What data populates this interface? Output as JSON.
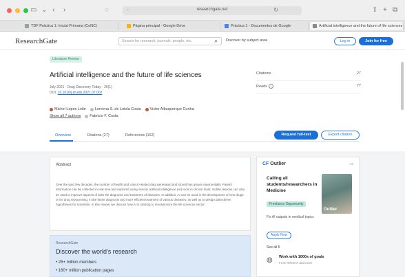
{
  "browser": {
    "colors": {
      "close": "#ff5f57",
      "minimize": "#febc2e",
      "maximize": "#28c840"
    },
    "url": "researchgate.net",
    "tabs": [
      {
        "label": "TDF Práctica 1: Inicial Primaria (CoNC)",
        "color": "#9aa0a6"
      },
      {
        "label": "Página principal - Google Drive",
        "color": "#f4b400"
      },
      {
        "label": "Práctica 1 - Documentos de Google",
        "color": "#4285f4"
      },
      {
        "label": "Artificial intelligence and the future of life sciences",
        "color": "#888888"
      }
    ]
  },
  "site": {
    "logo": "ResearchGate",
    "search_placeholder": "Search for research, journals, people, etc.",
    "discover": "Discover by subject area",
    "login": "Log in",
    "join": "Join for free"
  },
  "article": {
    "badge": "Literature Review",
    "title": "Artificial intelligence and the future of life sciences",
    "meta": "July 2021 · Drug Discovery Today · 26(1)",
    "doi_label": "DOI:",
    "doi": "10.1016/j.drudis.2021.07.002",
    "authors": [
      "Michel Lopes Leite",
      "Loreena S. de Loiola Costa",
      "Victor Albuquerque Cunha"
    ],
    "show_all": "Show all 7 authors",
    "last_author": "Fabricio F. Costa"
  },
  "stats": {
    "citations_label": "Citations",
    "citations_value": "27",
    "reads_label": "Reads",
    "reads_value": "77"
  },
  "tabs": {
    "overview": "Overview",
    "citations": "Citations (27)",
    "references": "References (162)",
    "request": "Request full-text",
    "export": "Export citation"
  },
  "abstract": {
    "label": "Abstract",
    "text": "Over the past few decades, the number of health and 'omics'-related data generated and stored has grown exponentially. Patient information can be collected in real time and explored using various artificial intelligence (AI) tools in clinical trials; mobile devices can also be used to improve aspects of both the diagnosis and treatment of diseases. In addition, AI can be used in the development of new drugs or for drug repurposing, in the faster diagnosis and more efficient treatment of various diseases, as well as to design data-driven hypotheses for scientists. In this review, we discuss how AI is starting to revolutionize the life sciences sector."
  },
  "promo": {
    "small": "ResearchGate",
    "title": "Discover the world's research",
    "items": [
      "25+ million members",
      "160+ million publication pages"
    ]
  },
  "ad": {
    "logo_mark": "CF",
    "logo": "Outlier",
    "tag": "Ad",
    "headline": "Calling all students/researchers in Medicine",
    "chip": "Freelance Opportunity",
    "photo_brand": "Outlier",
    "sub": "Fix AI outputs in medical topics",
    "apply": "Apply Now",
    "see_all": "See all 5",
    "item_title": "Work with 1000s of goals",
    "item_sub": "From TeleSAT and more"
  }
}
